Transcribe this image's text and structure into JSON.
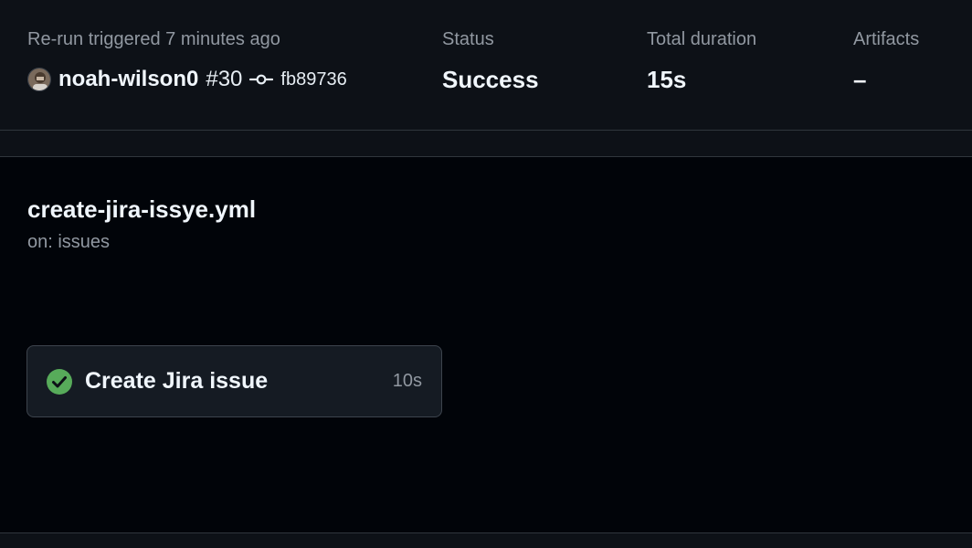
{
  "summary": {
    "trigger_label": "Re-run triggered 7 minutes ago",
    "actor": "noah-wilson0",
    "run_number": "#30",
    "commit_sha": "fb89736",
    "status_label": "Status",
    "status_value": "Success",
    "duration_label": "Total duration",
    "duration_value": "15s",
    "artifacts_label": "Artifacts",
    "artifacts_value": "–"
  },
  "workflow": {
    "file_name": "create-jira-issye.yml",
    "trigger": "on: issues",
    "jobs": [
      {
        "name": "Create Jira issue",
        "duration": "10s",
        "status": "success",
        "status_icon": "check-circle-fill-icon"
      }
    ]
  },
  "colors": {
    "success": "#57ab5a",
    "background": "#010409",
    "header_background": "#0d1117",
    "border": "#30363d",
    "muted_text": "#9198a1"
  }
}
